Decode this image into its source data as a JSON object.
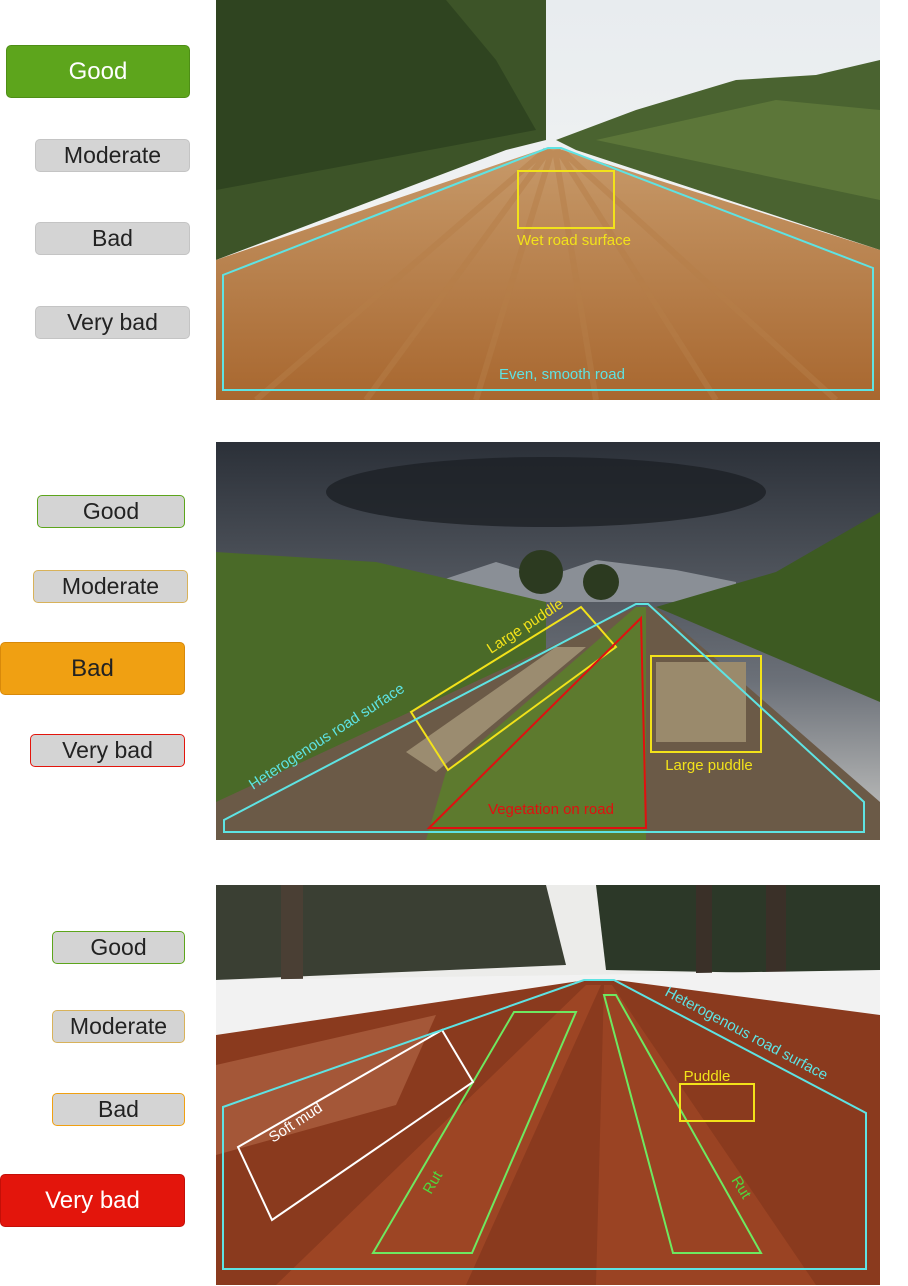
{
  "colors": {
    "good": "#5da51c",
    "bad": "#f0a012",
    "very_bad": "#e3150c",
    "road_outline": "#5ee3e3",
    "puddle": "#f2e21a",
    "vegetation": "#e01010",
    "rut": "#6ee860",
    "mud": "#ffffff"
  },
  "panels": [
    {
      "rating": "Good",
      "buttons": [
        "Good",
        "Moderate",
        "Bad",
        "Very bad"
      ],
      "annotations": {
        "wet": "Wet road surface",
        "even": "Even, smooth road"
      }
    },
    {
      "rating": "Bad",
      "buttons": [
        "Good",
        "Moderate",
        "Bad",
        "Very bad"
      ],
      "annotations": {
        "puddle_a": "Large puddle",
        "puddle_b": "Large puddle",
        "hetero": "Heterogenous road surface",
        "veg": "Vegetation on road"
      }
    },
    {
      "rating": "Very bad",
      "buttons": [
        "Good",
        "Moderate",
        "Bad",
        "Very bad"
      ],
      "annotations": {
        "hetero": "Heterogenous road surface",
        "puddle": "Puddle",
        "mud": "Soft mud",
        "rut_left": "Rut",
        "rut_right": "Rut"
      }
    }
  ]
}
